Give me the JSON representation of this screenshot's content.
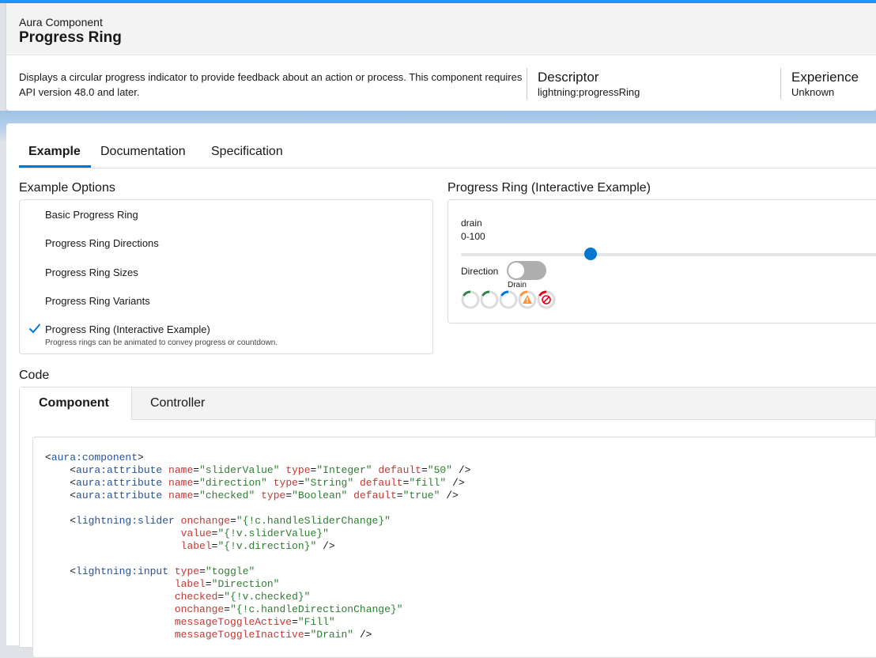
{
  "header": {
    "eyebrow": "Aura Component",
    "title": "Progress Ring",
    "description": "Displays a circular progress indicator to provide feedback about an action or process. This component requires API version 48.0 and later.",
    "descriptor_label": "Descriptor",
    "descriptor_value": "lightning:progressRing",
    "experience_label": "Experience",
    "experience_value": "Unknown"
  },
  "tabs": [
    {
      "label": "Example",
      "active": true
    },
    {
      "label": "Documentation",
      "active": false
    },
    {
      "label": "Specification",
      "active": false
    }
  ],
  "options": {
    "heading": "Example Options",
    "items": [
      {
        "label": "Basic Progress Ring"
      },
      {
        "label": "Progress Ring Directions"
      },
      {
        "label": "Progress Ring Sizes"
      },
      {
        "label": "Progress Ring Variants"
      },
      {
        "label": "Progress Ring (Interactive Example)",
        "selected": true,
        "subtext": "Progress rings can be animated to convey progress or countdown."
      }
    ]
  },
  "demo": {
    "heading": "Progress Ring (Interactive Example)",
    "slider_label": "drain",
    "slider_range": "0-100",
    "slider_value": 30,
    "toggle_label": "Direction",
    "toggle_state": "Drain",
    "rings": [
      {
        "variant": "base",
        "color": "#2e844a"
      },
      {
        "variant": "base",
        "color": "#2e844a"
      },
      {
        "variant": "active",
        "color": "#0176d3"
      },
      {
        "variant": "warning",
        "color": "#fe9339",
        "icon": "warning-icon"
      },
      {
        "variant": "expired",
        "color": "#ea001e",
        "icon": "ban-icon"
      }
    ]
  },
  "code": {
    "heading": "Code",
    "tabs": [
      {
        "label": "Component",
        "active": true
      },
      {
        "label": "Controller",
        "active": false
      }
    ]
  },
  "colors": {
    "brand": "#0176d3",
    "accent_bar": "#1b96ff"
  }
}
